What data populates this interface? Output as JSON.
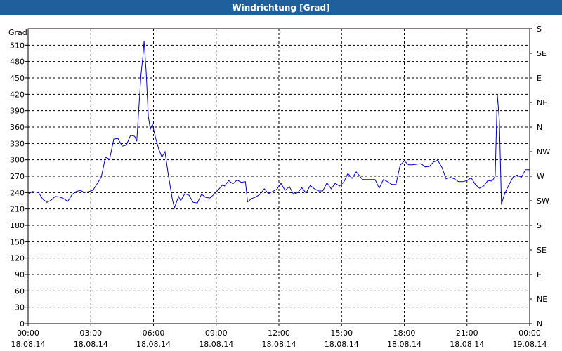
{
  "window": {
    "title": "Windrichtung [Grad]",
    "title_bar_color": "#1f5f9c"
  },
  "chart_data": {
    "type": "line",
    "title": "Windrichtung [Grad]",
    "ylabel": "Grad",
    "ylim": [
      0,
      540
    ],
    "yticks": [
      0,
      30,
      60,
      90,
      120,
      150,
      180,
      210,
      240,
      270,
      300,
      330,
      360,
      390,
      420,
      450,
      480,
      510
    ],
    "right_axis_labels": [
      {
        "value": 0,
        "label": "N"
      },
      {
        "value": 45,
        "label": "NE"
      },
      {
        "value": 90,
        "label": "E"
      },
      {
        "value": 135,
        "label": "SE"
      },
      {
        "value": 180,
        "label": "S"
      },
      {
        "value": 225,
        "label": "SW"
      },
      {
        "value": 270,
        "label": "W"
      },
      {
        "value": 315,
        "label": "NW"
      },
      {
        "value": 360,
        "label": "N"
      },
      {
        "value": 405,
        "label": "NE"
      },
      {
        "value": 450,
        "label": "E"
      },
      {
        "value": 495,
        "label": "SE"
      },
      {
        "value": 540,
        "label": "S"
      }
    ],
    "xlim": [
      0,
      24
    ],
    "x_unit": "hours since 18.08.14 00:00",
    "xticks": [
      {
        "x": 0,
        "time": "00:00",
        "date": "18.08.14"
      },
      {
        "x": 3,
        "time": "03:00",
        "date": "18.08.14"
      },
      {
        "x": 6,
        "time": "06:00",
        "date": "18.08.14"
      },
      {
        "x": 9,
        "time": "09:00",
        "date": "18.08.14"
      },
      {
        "x": 12,
        "time": "12:00",
        "date": "18.08.14"
      },
      {
        "x": 15,
        "time": "15:00",
        "date": "18.08.14"
      },
      {
        "x": 18,
        "time": "18:00",
        "date": "18.08.14"
      },
      {
        "x": 21,
        "time": "21:00",
        "date": "18.08.14"
      },
      {
        "x": 24,
        "time": "00:00",
        "date": "19.08.14"
      }
    ],
    "grid": true,
    "series": [
      {
        "color": "#0000cc",
        "points": [
          [
            0,
            237
          ],
          [
            0.2,
            242
          ],
          [
            0.5,
            240
          ],
          [
            0.7,
            228
          ],
          [
            0.9,
            222
          ],
          [
            1.1,
            226
          ],
          [
            1.3,
            233
          ],
          [
            1.5,
            232
          ],
          [
            1.7,
            229
          ],
          [
            1.9,
            224
          ],
          [
            2.1,
            236
          ],
          [
            2.3,
            242
          ],
          [
            2.5,
            244
          ],
          [
            2.7,
            240
          ],
          [
            2.9,
            242
          ],
          [
            3.1,
            244
          ],
          [
            3.3,
            256
          ],
          [
            3.5,
            268
          ],
          [
            3.6,
            286
          ],
          [
            3.7,
            305
          ],
          [
            3.9,
            301
          ],
          [
            4.1,
            338
          ],
          [
            4.3,
            339
          ],
          [
            4.5,
            325
          ],
          [
            4.7,
            327
          ],
          [
            4.9,
            345
          ],
          [
            5.1,
            343
          ],
          [
            5.2,
            334
          ],
          [
            5.3,
            396
          ],
          [
            5.4,
            456
          ],
          [
            5.5,
            492
          ],
          [
            5.55,
            518
          ],
          [
            5.65,
            460
          ],
          [
            5.75,
            380
          ],
          [
            5.85,
            356
          ],
          [
            5.95,
            365
          ],
          [
            6.1,
            340
          ],
          [
            6.25,
            320
          ],
          [
            6.4,
            305
          ],
          [
            6.55,
            315
          ],
          [
            6.7,
            275
          ],
          [
            6.9,
            228
          ],
          [
            7.0,
            212
          ],
          [
            7.2,
            233
          ],
          [
            7.3,
            225
          ],
          [
            7.5,
            238
          ],
          [
            7.7,
            235
          ],
          [
            7.9,
            222
          ],
          [
            8.1,
            221
          ],
          [
            8.3,
            237
          ],
          [
            8.5,
            231
          ],
          [
            8.7,
            230
          ],
          [
            8.9,
            237
          ],
          [
            9.1,
            245
          ],
          [
            9.3,
            254
          ],
          [
            9.4,
            252
          ],
          [
            9.6,
            262
          ],
          [
            9.8,
            256
          ],
          [
            10.0,
            263
          ],
          [
            10.2,
            259
          ],
          [
            10.4,
            260
          ],
          [
            10.5,
            223
          ],
          [
            10.7,
            229
          ],
          [
            10.9,
            232
          ],
          [
            11.1,
            237
          ],
          [
            11.3,
            247
          ],
          [
            11.5,
            238
          ],
          [
            11.7,
            242
          ],
          [
            11.9,
            246
          ],
          [
            12.1,
            257
          ],
          [
            12.3,
            244
          ],
          [
            12.5,
            251
          ],
          [
            12.7,
            237
          ],
          [
            12.9,
            240
          ],
          [
            13.1,
            249
          ],
          [
            13.3,
            239
          ],
          [
            13.5,
            253
          ],
          [
            13.7,
            247
          ],
          [
            13.9,
            243
          ],
          [
            14.1,
            243
          ],
          [
            14.3,
            258
          ],
          [
            14.5,
            247
          ],
          [
            14.7,
            257
          ],
          [
            14.9,
            252
          ],
          [
            15.1,
            259
          ],
          [
            15.3,
            275
          ],
          [
            15.5,
            266
          ],
          [
            15.7,
            278
          ],
          [
            16.0,
            264
          ],
          [
            16.3,
            264
          ],
          [
            16.6,
            264
          ],
          [
            16.8,
            248
          ],
          [
            17.0,
            264
          ],
          [
            17.2,
            260
          ],
          [
            17.4,
            255
          ],
          [
            17.6,
            255
          ],
          [
            17.8,
            290
          ],
          [
            18.0,
            298
          ],
          [
            18.2,
            291
          ],
          [
            18.4,
            291
          ],
          [
            18.6,
            292
          ],
          [
            18.8,
            293
          ],
          [
            19.0,
            287
          ],
          [
            19.2,
            288
          ],
          [
            19.4,
            296
          ],
          [
            19.6,
            299
          ],
          [
            19.8,
            286
          ],
          [
            20.0,
            265
          ],
          [
            20.2,
            268
          ],
          [
            20.4,
            265
          ],
          [
            20.6,
            260
          ],
          [
            20.8,
            260
          ],
          [
            21.0,
            262
          ],
          [
            21.2,
            267
          ],
          [
            21.4,
            255
          ],
          [
            21.6,
            248
          ],
          [
            21.8,
            252
          ],
          [
            22.0,
            262
          ],
          [
            22.2,
            261
          ],
          [
            22.35,
            270
          ],
          [
            22.45,
            420
          ],
          [
            22.55,
            370
          ],
          [
            22.65,
            218
          ],
          [
            22.75,
            232
          ],
          [
            22.85,
            242
          ],
          [
            23.0,
            254
          ],
          [
            23.2,
            268
          ],
          [
            23.4,
            272
          ],
          [
            23.6,
            268
          ],
          [
            23.8,
            282
          ],
          [
            24.0,
            282
          ]
        ]
      }
    ]
  }
}
